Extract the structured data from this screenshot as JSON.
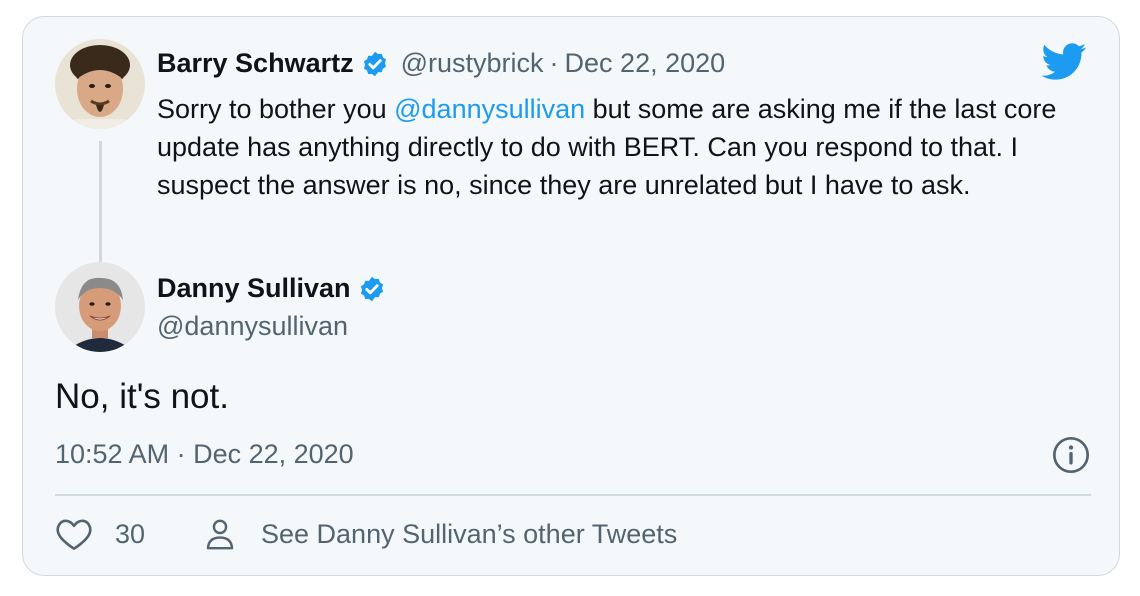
{
  "quoted_tweet": {
    "author_name": "Barry Schwartz",
    "author_handle": "@rustybrick",
    "separator": "·",
    "date": "Dec 22, 2020",
    "text_before": "Sorry to bother you ",
    "mention": "@dannysullivan",
    "text_after": " but some are asking me if the last core update has anything directly to do with BERT.  Can you respond to that.  I suspect the answer is no, since they are unrelated but I have to ask."
  },
  "reply_tweet": {
    "author_name": "Danny Sullivan",
    "author_handle": "@dannysullivan",
    "text": "No, it's not.",
    "timestamp": "10:52 AM · Dec 22, 2020"
  },
  "footer": {
    "like_count": "30",
    "profile_link": "See Danny Sullivan’s other Tweets"
  },
  "icons": {
    "brand": "twitter-bird-icon",
    "verified": "verified-badge-icon",
    "info": "info-icon",
    "like": "heart-icon",
    "profile": "person-icon"
  },
  "colors": {
    "twitter_blue": "#1d9bf0",
    "secondary_text": "#536471",
    "card_background": "#f5f8fa"
  }
}
